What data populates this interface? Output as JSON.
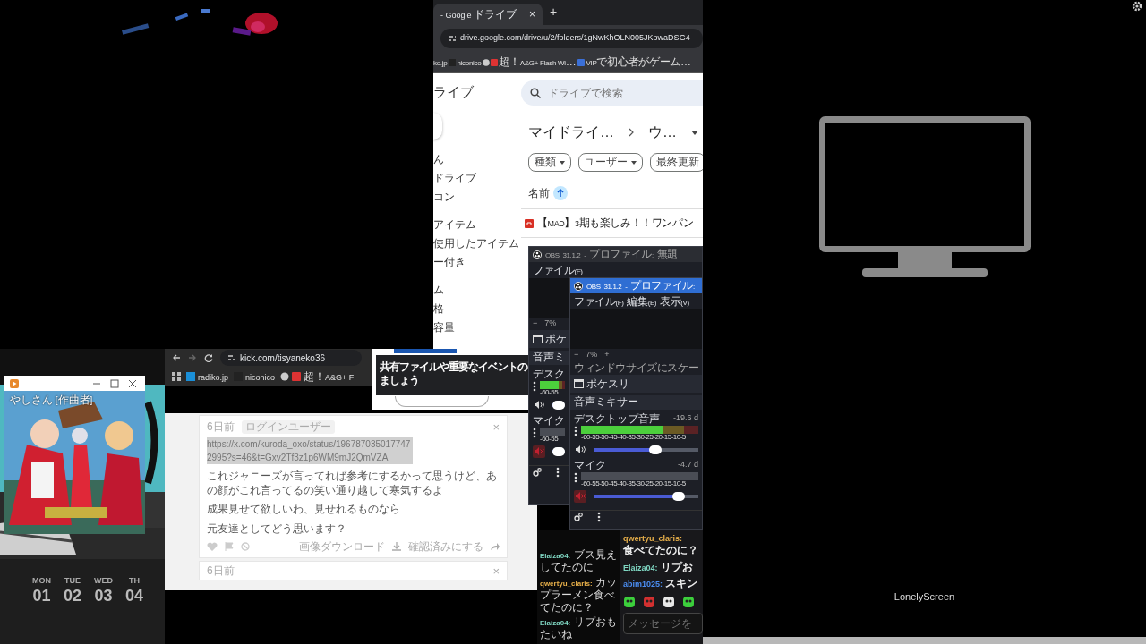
{
  "drive_window": {
    "tab_title": "- Google ドライブ",
    "close_glyph": "×",
    "new_tab_glyph": "+",
    "url": "drive.google.com/drive/u/2/folders/1gNwKhOLN005JKowaDSG4",
    "bookmarks": [
      "ko.jp",
      "niconico",
      "超！A&G+ Flash Wi…",
      "VIPで初心者がゲーム…"
    ],
    "app_title": "ライブ",
    "sidebar_groups": [
      [
        "ん",
        "ドライブ",
        "コン"
      ],
      [
        "アイテム",
        "使用したアイテム",
        "ー付き"
      ],
      [
        "ム",
        "格",
        "容量"
      ]
    ],
    "search_placeholder": "ドライブで検索",
    "breadcrumb": [
      "マイドライ…",
      "ウ…"
    ],
    "filters": [
      "種類",
      "ユーザー",
      "最終更新"
    ],
    "sort_column": "名前",
    "files": [
      "【MAD】3期も楽しみ！！ワンパン"
    ]
  },
  "notification": {
    "lines": [
      "共有ファイルや重要なイベントの",
      "ましょう"
    ]
  },
  "kick_window": {
    "url": "kick.com/tisyaneko36",
    "bookmarks": [
      "radiko.jp",
      "niconico",
      "超！A&G+ F"
    ],
    "comments": [
      {
        "time": "6日前",
        "badge": "ログインユーザー",
        "link": "https://x.com/kuroda_oxo/status/1967870350177472995?s=46&t=Gxv2Tf3z1p6WM9mJ2QmVZA",
        "paragraphs": [
          "これジャニーズが言ってれば参考にするかって思うけど、あの顔がこれ言ってるの笑い通り越して寒気するよ",
          "成果見せて欲しいわ、見せれるものなら",
          "元友達としてどう思います？"
        ],
        "actions": [
          "画像ダウンロード",
          "確認済みにする"
        ]
      },
      {
        "time": "6日前"
      }
    ]
  },
  "music_player": {
    "caption": "やしさん [作曲者]"
  },
  "calendar": [
    {
      "day": "MON",
      "date": "01"
    },
    {
      "day": "TUE",
      "date": "02"
    },
    {
      "day": "WED",
      "date": "03"
    },
    {
      "day": "TH",
      "date": "04"
    }
  ],
  "small_chat": [
    {
      "user": "Elaiza04:",
      "text": "ブス見えしてたのに",
      "color": "#7fd6c2"
    },
    {
      "user": "qwertyu_claris:",
      "text": "カップラーメン食べてたのに？",
      "color": "#e8b04a"
    },
    {
      "user": "Elaiza04:",
      "text": "リプおもたいね",
      "color": "#7fd6c2"
    }
  ],
  "big_chat": {
    "messages": [
      {
        "kind": "wrapped",
        "user": "qwertyu_claris:",
        "text": "食べてたのに？",
        "color": "#e8b04a"
      },
      {
        "kind": "inline",
        "user": "Elaiza04:",
        "text": "リプお",
        "color": "#7fd6c2"
      },
      {
        "kind": "inline",
        "user": "abim1025:",
        "text": "スキン",
        "color": "#4a8cf0"
      }
    ],
    "input_placeholder": "メッセージを"
  },
  "obs_windows": [
    {
      "active": false,
      "title": "OBS 31.1.2 - プロファイル: 無題",
      "menu": [
        "ファイル(F)"
      ],
      "zoom": "7%",
      "minus": "−",
      "scene": "ポケ",
      "mixer_title": "音声ミ",
      "channels": [
        {
          "name": "デスク",
          "muted": false,
          "ticks": "-60-55",
          "meter": {
            "level": 0.75
          },
          "volume": {
            "level": 0.6
          }
        },
        {
          "name": "マイク",
          "muted": true,
          "ticks": "-60-55",
          "volume": {
            "level": 0.85
          }
        }
      ]
    },
    {
      "active": true,
      "title": "OBS 31.1.2 - プロファイル:",
      "menu": [
        "ファイル(F)",
        "編集(E)",
        "表示(V)"
      ],
      "zoom": "7%",
      "minus": "−",
      "plus": "+",
      "scale_label": "ウィンドウサイズにスケー",
      "scene": "ポケスリ",
      "mixer_title": "音声ミキサー",
      "channels": [
        {
          "name": "デスクトップ音声",
          "reading": "-19.6 d",
          "muted": false,
          "ticks": "-60-55-50-45-40-35-30-25-20-15-10-5",
          "meter": {
            "level": 0.7
          },
          "volume": {
            "level": 0.6
          }
        },
        {
          "name": "マイク",
          "reading": "-4.7 d",
          "muted": true,
          "ticks": "-60-55-50-45-40-35-30-25-20-15-10-5",
          "meter": {
            "level": 0
          },
          "volume": {
            "level": 0.85
          }
        }
      ]
    }
  ],
  "lonely_screen": {
    "label": "LonelyScreen"
  }
}
